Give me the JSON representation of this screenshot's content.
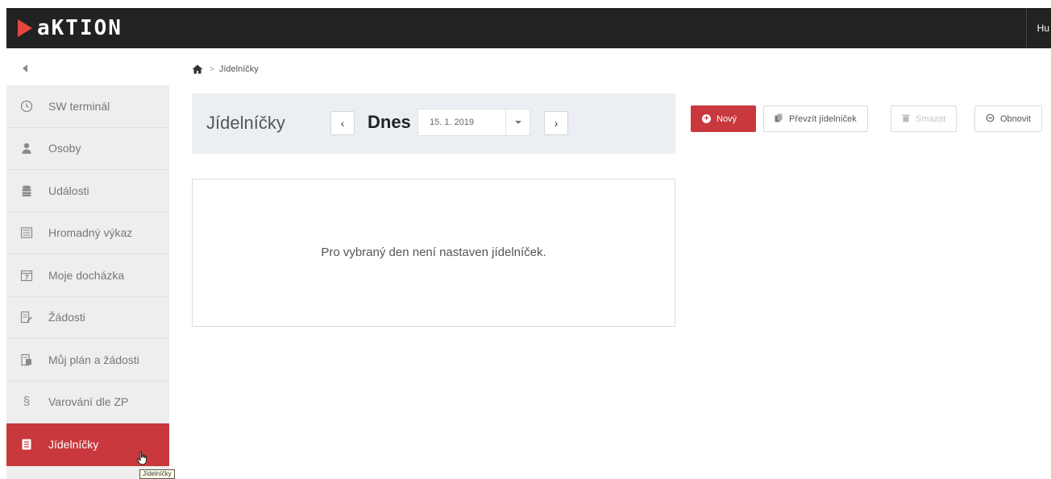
{
  "brand": {
    "logo_text": "aKTION"
  },
  "user": {
    "name_partial": "Hu"
  },
  "breadcrumb": {
    "current": "Jídelníčky"
  },
  "sidebar": {
    "items": [
      {
        "label": "SW terminál",
        "icon": "clock-icon",
        "active": false
      },
      {
        "label": "Osoby",
        "icon": "person-icon",
        "active": false
      },
      {
        "label": "Události",
        "icon": "database-icon",
        "active": false
      },
      {
        "label": "Hromadný výkaz",
        "icon": "report-icon",
        "active": false
      },
      {
        "label": "Moje docházka",
        "icon": "calendar-icon",
        "active": false
      },
      {
        "label": "Žádosti",
        "icon": "request-icon",
        "active": false
      },
      {
        "label": "Můj plán a žádosti",
        "icon": "plan-icon",
        "active": false
      },
      {
        "label": "Varování dle ZP",
        "icon": "paragraph-icon",
        "active": false
      },
      {
        "label": "Jídelníčky",
        "icon": "document-icon",
        "active": true
      }
    ],
    "tooltip": "Jídelníčky"
  },
  "header": {
    "title": "Jídelníčky",
    "prev": "‹",
    "next": "›",
    "today_label": "Dnes",
    "date_value": "15. 1. 2019"
  },
  "toolbar": {
    "new_label": "Nový",
    "take_over_label": "Převzít jídelníček",
    "delete_label": "Smazat",
    "refresh_label": "Obnovit"
  },
  "content": {
    "empty_message": "Pro vybraný den není nastaven jídelníček."
  },
  "colors": {
    "accent": "#c8383c",
    "topbar": "#222222",
    "sidebar_bg": "#eeeeee",
    "logo_mark": "#e8463c"
  }
}
